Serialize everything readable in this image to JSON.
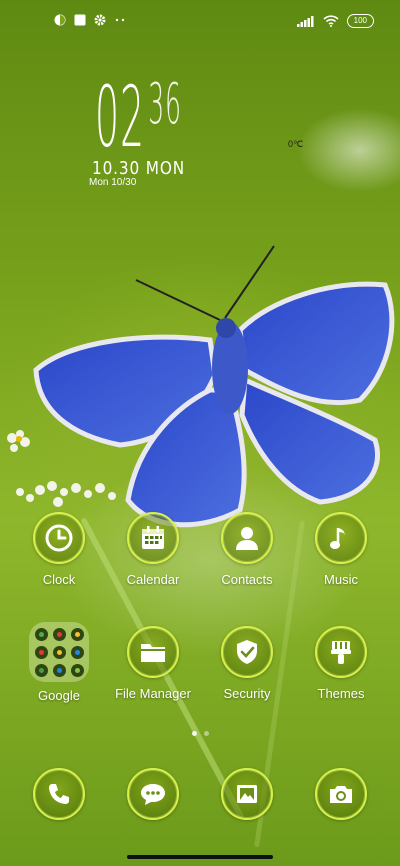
{
  "status_bar": {
    "left_icons": [
      "notification-icon",
      "square-notification-icon",
      "gear-icon",
      "more-icon"
    ],
    "right_icons": [
      "signal-icon",
      "wifi-icon",
      "battery-icon"
    ],
    "battery_level": "100"
  },
  "clock": {
    "hour": "02",
    "minute": "36",
    "date_large": "10.30 MON",
    "date_small": "Mon 10/30",
    "weather": "0℃"
  },
  "apps_row1": [
    {
      "label": "Clock",
      "icon": "clock-icon"
    },
    {
      "label": "Calendar",
      "icon": "calendar-icon"
    },
    {
      "label": "Contacts",
      "icon": "contact-icon"
    },
    {
      "label": "Music",
      "icon": "music-note-icon"
    }
  ],
  "apps_row2": [
    {
      "label": "Google",
      "icon": "folder-icon"
    },
    {
      "label": "File Manager",
      "icon": "folder-file-icon"
    },
    {
      "label": "Security",
      "icon": "shield-check-icon"
    },
    {
      "label": "Themes",
      "icon": "paint-brush-icon"
    }
  ],
  "folder_apps": [
    "google-icon",
    "gmail-icon",
    "maps-icon",
    "youtube-icon",
    "chrome-icon",
    "drive-icon",
    "photos-icon",
    "duo-icon",
    "play-icon"
  ],
  "page_indicator": {
    "pages": 2,
    "current": 1
  },
  "dock": [
    {
      "icon": "phone-icon"
    },
    {
      "icon": "messaging-icon"
    },
    {
      "icon": "gallery-icon"
    },
    {
      "icon": "camera-icon"
    }
  ],
  "colors": {
    "accent": "#d8f04a",
    "wallpaper": "#7aa31e",
    "butterfly": "#3b5bd6"
  }
}
